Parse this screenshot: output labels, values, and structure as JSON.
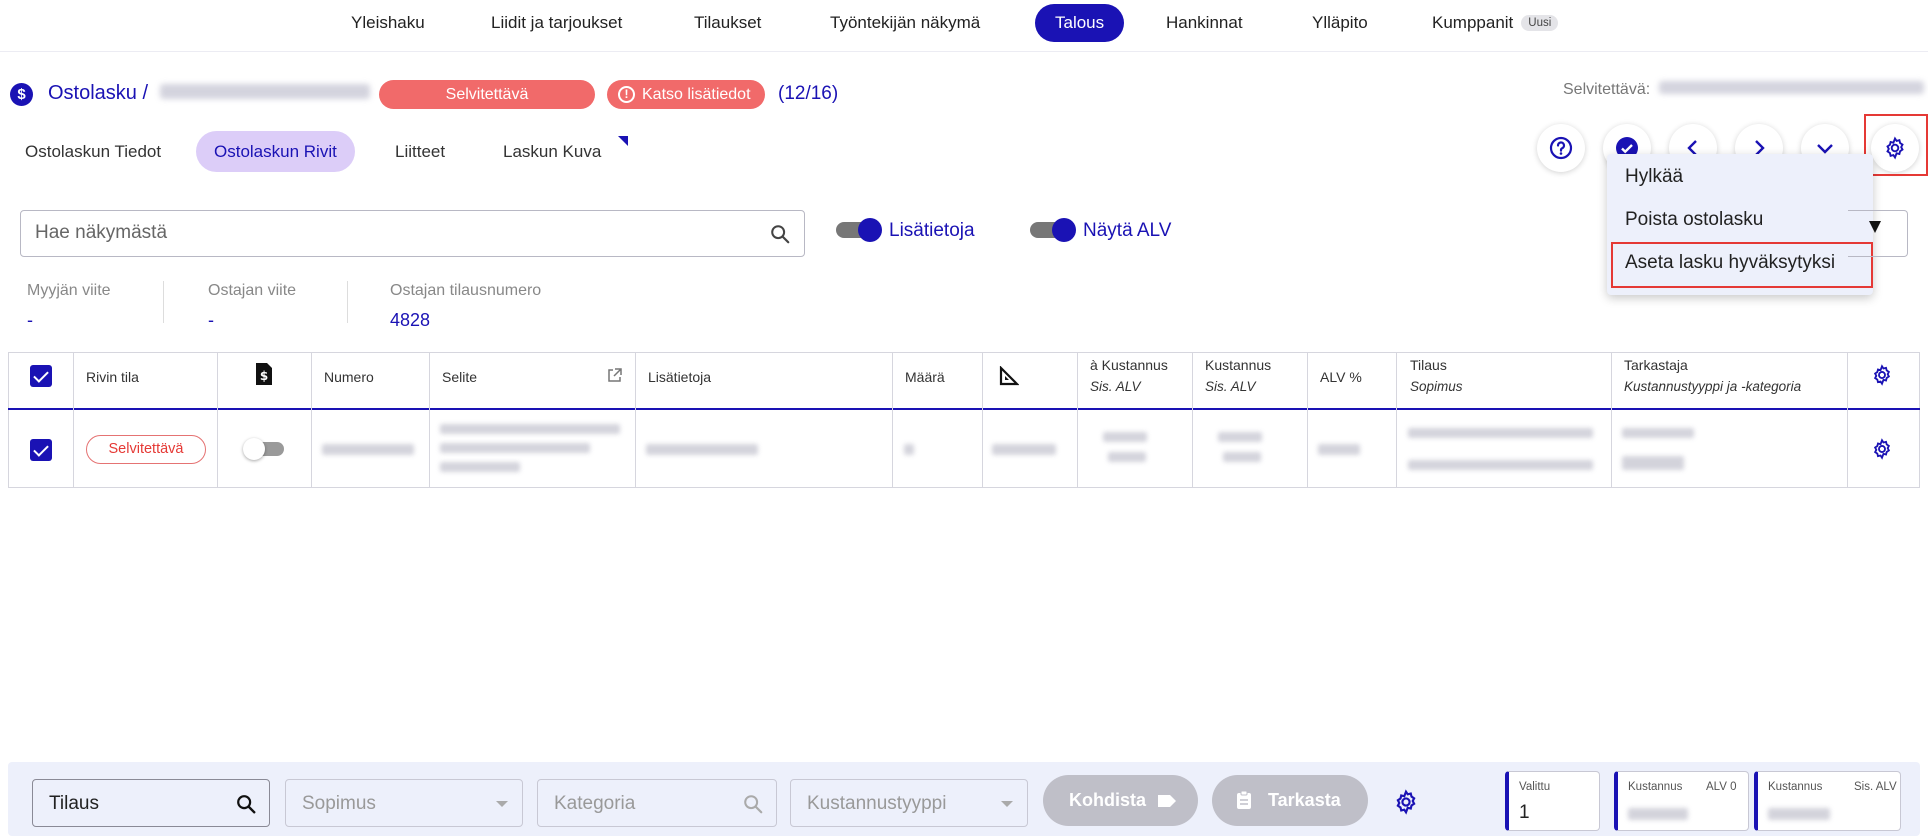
{
  "nav": {
    "items": [
      {
        "label": "Yleishaku"
      },
      {
        "label": "Liidit ja tarjoukset"
      },
      {
        "label": "Tilaukset"
      },
      {
        "label": "Työntekijän näkymä"
      },
      {
        "label": "Talous"
      },
      {
        "label": "Hankinnat"
      },
      {
        "label": "Ylläpito"
      },
      {
        "label": "Kumppanit"
      }
    ],
    "active": "Talous",
    "badge": "Uusi"
  },
  "header": {
    "title": "Ostolasku /",
    "status": "Selvitettävä",
    "info_button": "Katso lisätiedot",
    "counter": "(12/16)",
    "right_status_label": "Selvitettävä:"
  },
  "subtabs": [
    {
      "label": "Ostolaskun Tiedot"
    },
    {
      "label": "Ostolaskun Rivit"
    },
    {
      "label": "Liitteet"
    },
    {
      "label": "Laskun Kuva"
    }
  ],
  "active_subtab": "Ostolaskun Rivit",
  "dropdown": {
    "items": [
      {
        "label": "Hylkää"
      },
      {
        "label": "Poista ostolasku"
      },
      {
        "label": "Aseta lasku hyväksytyksi"
      }
    ]
  },
  "search": {
    "placeholder": "Hae näkymästä"
  },
  "toggles": {
    "lisatietoja": {
      "label": "Lisätietoja",
      "on": true
    },
    "nayta_alv": {
      "label": "Näytä ALV",
      "on": true
    }
  },
  "refs": [
    {
      "label": "Myyjän viite",
      "value": "-"
    },
    {
      "label": "Ostajan viite",
      "value": "-"
    },
    {
      "label": "Ostajan tilausnumero",
      "value": "4828"
    }
  ],
  "table": {
    "headers": {
      "rivin_tila": "Rivin tila",
      "numero": "Numero",
      "selite": "Selite",
      "lisatietoja": "Lisätietoja",
      "maara": "Määrä",
      "a_kustannus": "à Kustannus",
      "a_kustannus_sub": "Sis. ALV",
      "kustannus": "Kustannus",
      "kustannus_sub": "Sis. ALV",
      "alv": "ALV %",
      "tilaus": "Tilaus",
      "tilaus_sub": "Sopimus",
      "tarkastaja": "Tarkastaja",
      "tarkastaja_sub": "Kustannustyyppi ja -kategoria"
    },
    "rows": [
      {
        "status": "Selvitettävä",
        "checked": true,
        "toggle_on": false
      }
    ]
  },
  "bottom": {
    "tilaus_value": "Tilaus",
    "sopimus_placeholder": "Sopimus",
    "kategoria_placeholder": "Kategoria",
    "kustannustyyppi_placeholder": "Kustannustyyppi",
    "kohdista": "Kohdista",
    "tarkasta": "Tarkasta",
    "valittu_label": "Valittu",
    "valittu_value": "1",
    "kustannus0_label": "Kustannus",
    "kustannus0_sub": "ALV 0",
    "kustannus_sis_label": "Kustannus",
    "kustannus_sis_sub": "Sis. ALV"
  },
  "colors": {
    "accent": "#1a12b4",
    "danger": "#f16a6a",
    "tab_active_bg": "#dccdf8"
  }
}
